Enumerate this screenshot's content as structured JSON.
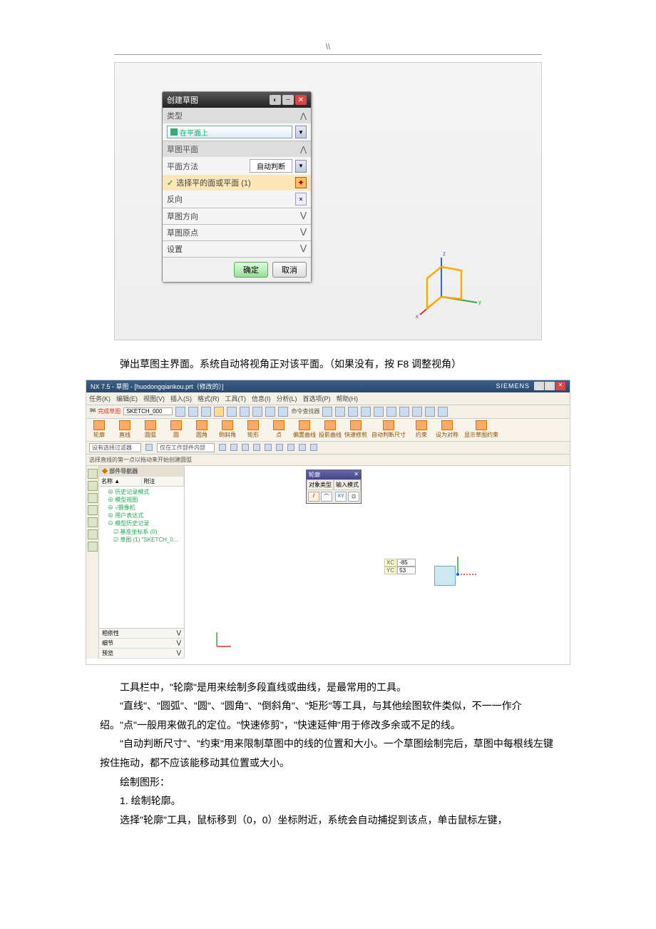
{
  "header": "\\\\",
  "dialog": {
    "title": "创建草图",
    "sec_type": "类型",
    "type_value": "在平面上",
    "sec_plane": "草图平面",
    "method_label": "平面方法",
    "method_value": "自动判断",
    "pick_label": "选择平的面或平面 (1)",
    "reverse": "反向",
    "sec_dir": "草图方向",
    "sec_origin": "草图原点",
    "sec_settings": "设置",
    "ok": "确定",
    "cancel": "取消"
  },
  "para1": "弹出草图主界面。系统自动将视角正对该平面。（如果没有，按 F8 调整视角）",
  "nx": {
    "title": "NX 7.5 - 草图 - [huodongqiankou.prt（修改的）]",
    "brand": "SIEMENS",
    "menu": [
      "任务(K)",
      "编辑(E)",
      "视图(V)",
      "插入(S)",
      "格式(R)",
      "工具(T)",
      "信息(I)",
      "分析(L)",
      "首选项(P)",
      "帮助(H)"
    ],
    "finish_label": "完成草图",
    "sketch_combo": "SKETCH_000",
    "cmd_finder": "命令查找器",
    "tools": [
      "轮廓",
      "直线",
      "圆弧",
      "圆",
      "圆角",
      "倒斜角",
      "矩形",
      "点",
      "偏置曲线",
      "投影曲线",
      "快速修剪",
      "自动判断尺寸",
      "约束",
      "设为对称",
      "显示草图约束"
    ],
    "filter1": "设有选择过滤器",
    "filter2": "仅在工作部件内部",
    "hint": "选择直线的第一点以拖动来开始创建圆弧",
    "nav_title": "部件导航器",
    "nav_cols": [
      "名称 ▲",
      "附注"
    ],
    "tree": {
      "a": "历史记录模式",
      "b": "模型视图",
      "c": "√摄像机",
      "d": "用户表达式",
      "e": "模型历史记录",
      "f": "基准坐标系 (0)",
      "g": "草图 (1) \"SKETCH_0..."
    },
    "nav_foot": [
      "相依性",
      "细节",
      "预览"
    ],
    "mini_title": "轮廓",
    "mini_tabs": [
      "对象类型",
      "输入模式"
    ],
    "mini_xy": "XY",
    "xc_label": "XC",
    "xc_val": "-85",
    "yc_label": "YC",
    "yc_val": "53"
  },
  "para2": "工具栏中，\"轮廓\"是用来绘制多段直线或曲线，是最常用的工具。",
  "para3": "\"直线\"、\"圆弧\"、\"圆\"、\"圆角\"、\"倒斜角\"、\"矩形\"等工具，与其他绘图软件类似，不一一作介绍。\"点\"一般用来做孔的定位。\"快速修剪\"，\"快速延伸\"用于修改多余或不足的线。",
  "para4": "\"自动判断尺寸\"、\"约束\"用来限制草图中的线的位置和大小。一个草图绘制完后，草图中每根线左键按住拖动，都不应该能移动其位置或大小。",
  "para5": "绘制图形：",
  "para6": "1. 绘制轮廓。",
  "para7": "选择\"轮廓\"工具，鼠标移到（0，0）坐标附近，系统会自动捕捉到该点，单击鼠标左键，"
}
